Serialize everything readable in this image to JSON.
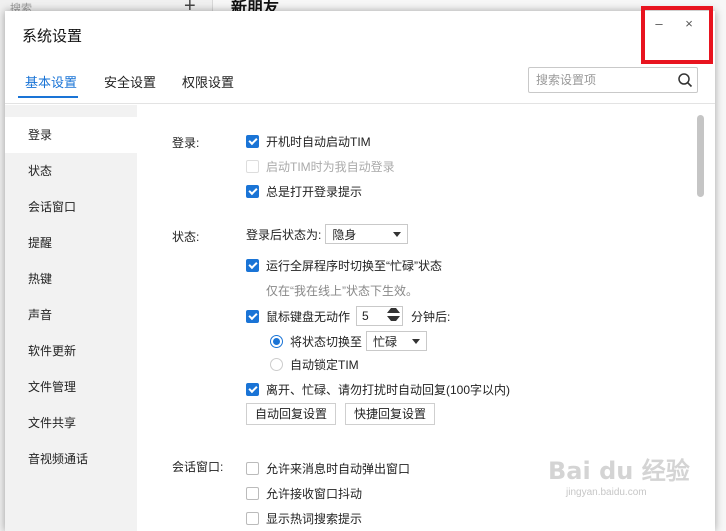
{
  "background": {
    "search_placeholder": "搜索",
    "plus": "+",
    "chat_title": "新朋友"
  },
  "dialog": {
    "title": "系统设置",
    "minimize": "–",
    "close": "×"
  },
  "tabs": [
    {
      "label": "基本设置",
      "active": true
    },
    {
      "label": "安全设置"
    },
    {
      "label": "权限设置"
    }
  ],
  "search": {
    "placeholder": "搜索设置项"
  },
  "sidebar": {
    "items": [
      {
        "label": "登录"
      },
      {
        "label": "状态"
      },
      {
        "label": "会话窗口"
      },
      {
        "label": "提醒"
      },
      {
        "label": "热键"
      },
      {
        "label": "声音"
      },
      {
        "label": "软件更新"
      },
      {
        "label": "文件管理"
      },
      {
        "label": "文件共享"
      },
      {
        "label": "音视频通话"
      }
    ]
  },
  "login": {
    "label": "登录:",
    "auto_start": "开机时自动启动TIM",
    "auto_login": "启动TIM时为我自动登录",
    "show_tips": "总是打开登录提示"
  },
  "status": {
    "label": "状态:",
    "after_login_label": "登录后状态为:",
    "after_login_value": "隐身",
    "fullscreen_busy": "运行全屏程序时切换至“忙碌”状态",
    "fullscreen_hint": "仅在“我在线上”状态下生效。",
    "idle_label": "鼠标键盘无动作",
    "idle_minutes": "5",
    "idle_suffix": "分钟后:",
    "switch_to": "将状态切换至",
    "switch_value": "忙碌",
    "auto_lock": "自动锁定TIM",
    "auto_reply": "离开、忙碌、请勿打扰时自动回复(100字以内)",
    "btn_auto_reply": "自动回复设置",
    "btn_quick_reply": "快捷回复设置"
  },
  "session": {
    "label": "会话窗口:",
    "popup": "允许来消息时自动弹出窗口",
    "shake": "允许接收窗口抖动",
    "hot_search": "显示热词搜索提示"
  },
  "watermark": {
    "text": "Bai du 经验",
    "url": "jingyan.baidu.com"
  },
  "colors": {
    "accent": "#1a74d6",
    "highlight": "#e8141f"
  }
}
